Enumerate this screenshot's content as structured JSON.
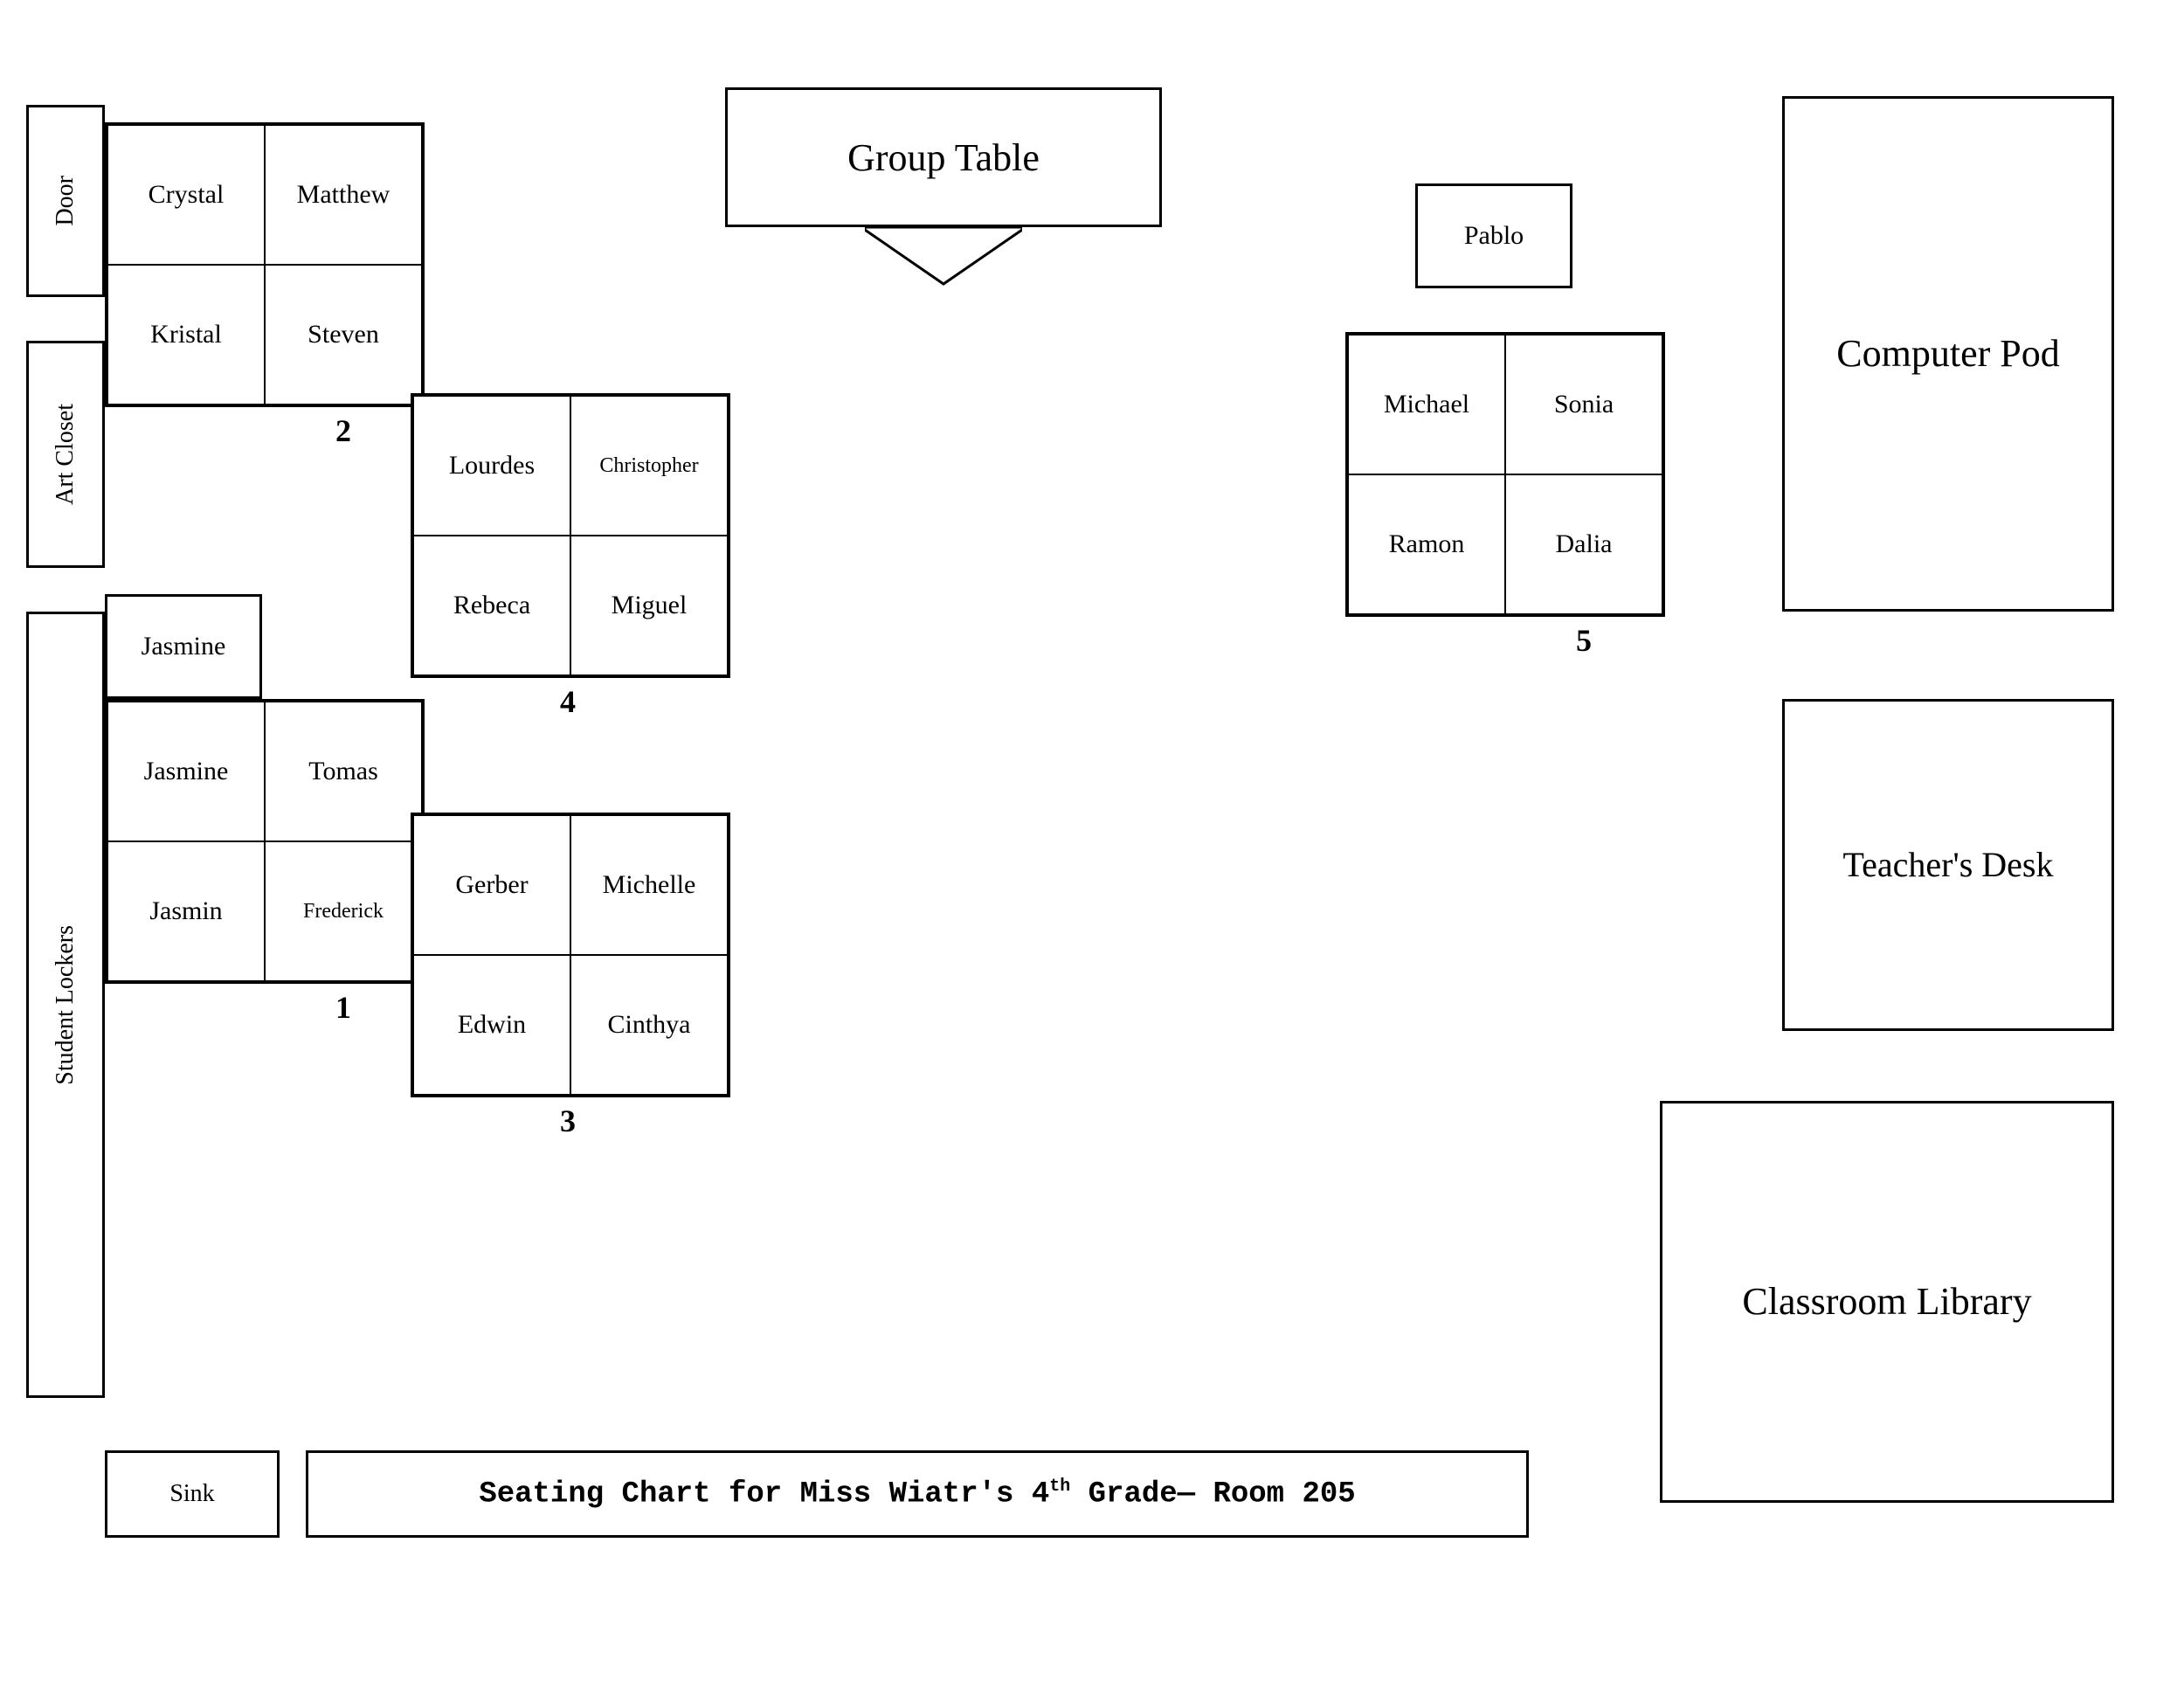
{
  "room": {
    "title": "Seating Chart for Miss Wiatr's 4",
    "title_grade": "th",
    "title_suffix": " Grade— Room 205"
  },
  "walls": {
    "door": "Door",
    "art_closet": "Art Closet",
    "student_lockers": "Student Lockers"
  },
  "areas": {
    "group_table": "Group Table",
    "computer_pod": "Computer Pod",
    "teachers_desk": "Teacher's Desk",
    "classroom_library": "Classroom Library",
    "sink": "Sink"
  },
  "clusters": {
    "cluster1": {
      "number": "1",
      "single": "Jasmine",
      "seats": [
        "Jasmine",
        "Tomas",
        "Jasmin",
        "Frederick"
      ]
    },
    "cluster2": {
      "number": "2",
      "seats": [
        "Crystal",
        "Matthew",
        "Kristal",
        "Steven"
      ]
    },
    "cluster3": {
      "number": "3",
      "seats": [
        "Gerber",
        "Michelle",
        "Edwin",
        "Cinthya"
      ]
    },
    "cluster4": {
      "number": "4",
      "seats": [
        "Lourdes",
        "Christopher",
        "Rebeca",
        "Miguel"
      ]
    },
    "cluster5": {
      "number": "5",
      "pablo": "Pablo",
      "seats": [
        "Michael",
        "Sonia",
        "Ramon",
        "Dalia"
      ]
    }
  }
}
